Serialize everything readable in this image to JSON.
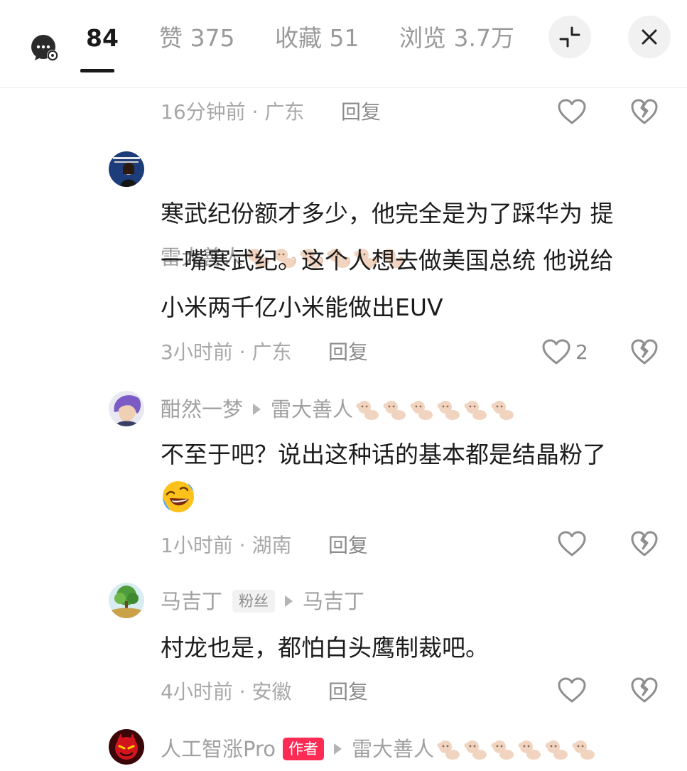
{
  "header": {
    "tabs": [
      {
        "label": "84"
      },
      {
        "label": "赞 375"
      },
      {
        "label": "收藏 51"
      },
      {
        "label": "浏览 3.7万"
      }
    ]
  },
  "prev_comment": {
    "meta": "16分钟前 · 广东",
    "reply": "回复"
  },
  "comments": [
    {
      "name": "雷大善人",
      "text_lines": [
        "寒武纪份额才多少，他完全是为了踩华为 提",
        "一嘴寒武纪。这个人想去做美国总统 他说给",
        "小米两千亿小米能做出EUV"
      ],
      "meta": "3小时前 · 广东",
      "reply": "回复",
      "likes": "2"
    },
    {
      "name": "酣然一梦",
      "reply_to": "雷大善人",
      "text_lines": [
        "不至于吧？说出这种话的基本都是结晶粉了"
      ],
      "meta": "1小时前 · 湖南",
      "reply": "回复"
    },
    {
      "name": "马吉丁",
      "badge": "粉丝",
      "reply_to": "马吉丁",
      "text_lines": [
        "村龙也是，都怕白头鹰制裁吧。"
      ],
      "meta": "4小时前 · 安徽",
      "reply": "回复"
    },
    {
      "name": "人工智涨Pro",
      "badge": "作者",
      "reply_to": "雷大善人"
    }
  ],
  "colors": {
    "accent": "#fe2c55",
    "text": "#1c1c1c",
    "muted": "#a8a8a8"
  },
  "icons": [
    "comment-settings-icon",
    "collapse-icon",
    "close-icon",
    "heart-icon",
    "broken-heart-icon",
    "monkey-emoji-icon",
    "laughing-crying-emoji-icon"
  ]
}
